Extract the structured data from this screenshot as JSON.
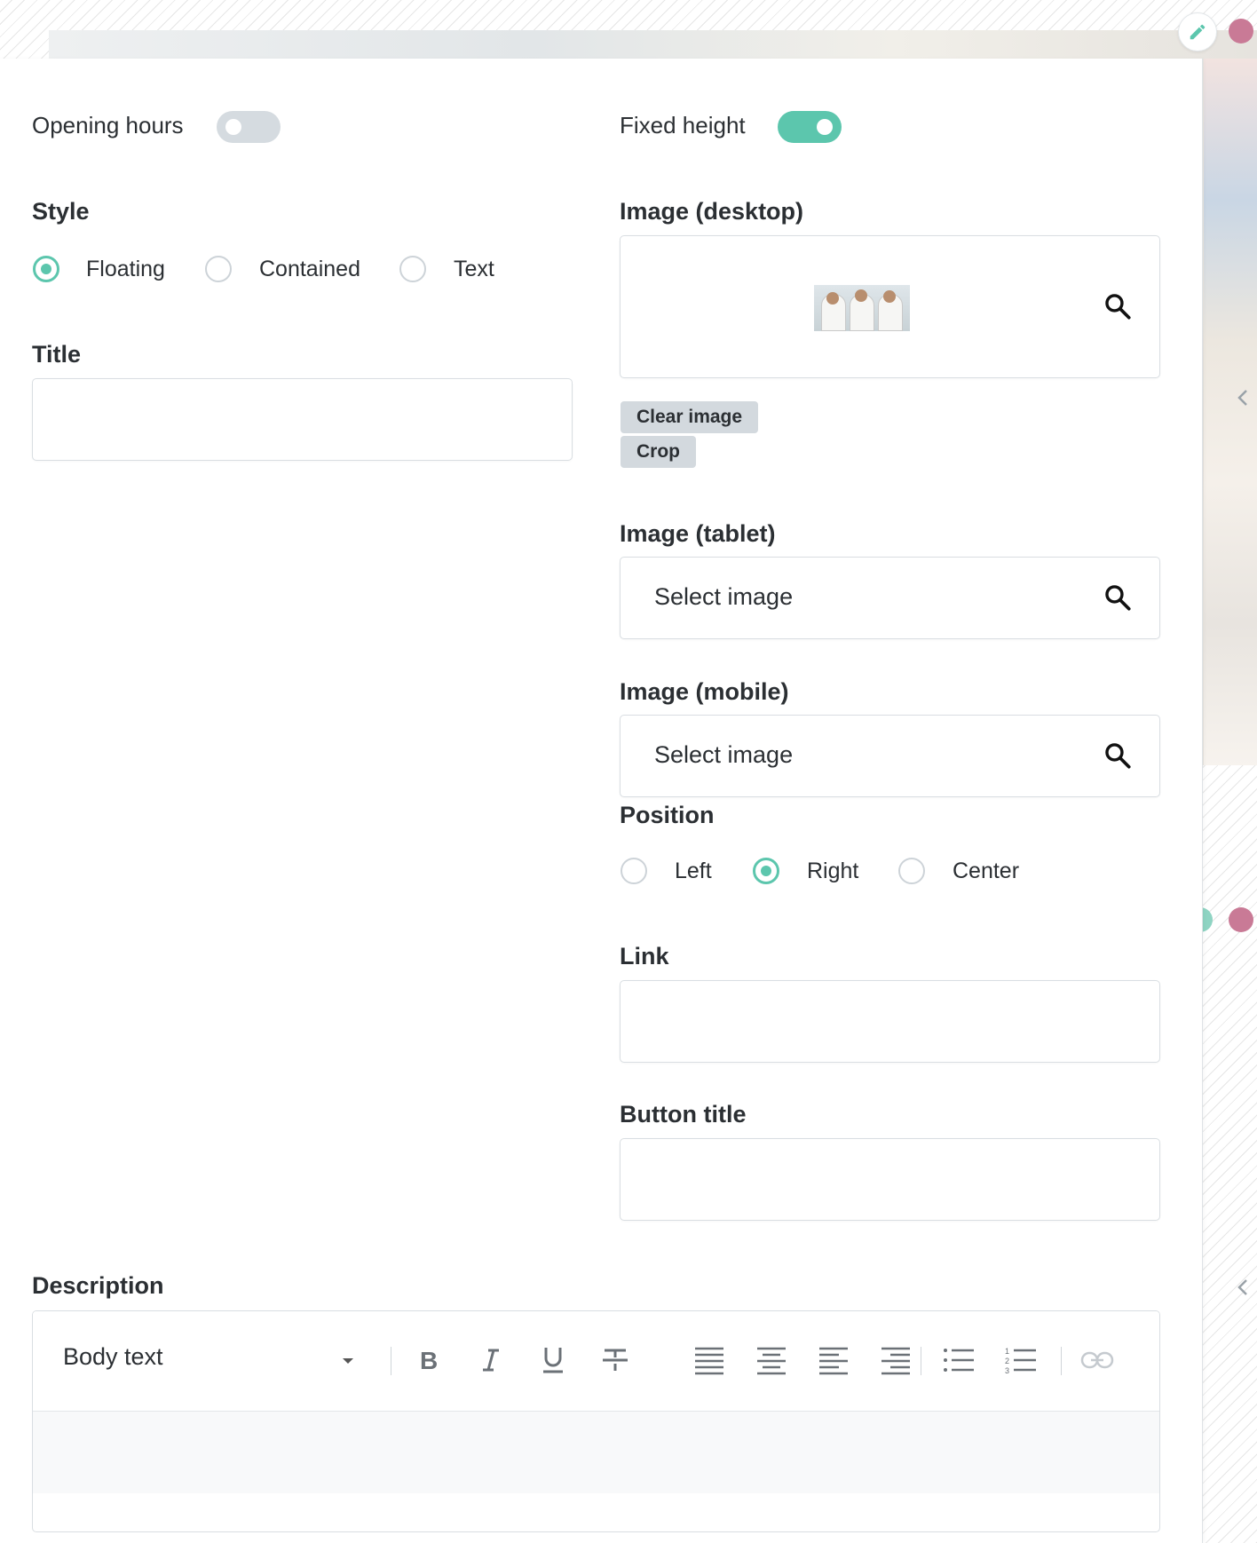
{
  "panel": {
    "opening_hours": {
      "label": "Opening hours",
      "enabled": false
    },
    "fixed_height": {
      "label": "Fixed height",
      "enabled": true
    },
    "style": {
      "label": "Style",
      "options": [
        "Floating",
        "Contained",
        "Text"
      ],
      "selected": "Floating"
    },
    "title": {
      "label": "Title",
      "value": ""
    },
    "image_desktop": {
      "label": "Image (desktop)",
      "clear_label": "Clear image",
      "crop_label": "Crop"
    },
    "image_tablet": {
      "label": "Image (tablet)",
      "placeholder": "Select image"
    },
    "image_mobile": {
      "label": "Image (mobile)",
      "placeholder": "Select image"
    },
    "position": {
      "label": "Position",
      "options": [
        "Left",
        "Right",
        "Center"
      ],
      "selected": "Right"
    },
    "link": {
      "label": "Link",
      "value": ""
    },
    "button_title": {
      "label": "Button title",
      "value": ""
    },
    "description": {
      "label": "Description",
      "format": "Body text",
      "toolbar": [
        "bold-icon",
        "italic-icon",
        "underline-icon",
        "strikethrough-icon",
        "align-justify-icon",
        "align-center-icon",
        "align-left-icon",
        "align-right-icon",
        "bullet-list-icon",
        "numbered-list-icon",
        "link-icon"
      ]
    }
  },
  "colors": {
    "accent": "#5cc6ad",
    "pink": "#c97a96",
    "toggle_off": "#d5dbe0",
    "button_gray": "#d3d9de"
  }
}
